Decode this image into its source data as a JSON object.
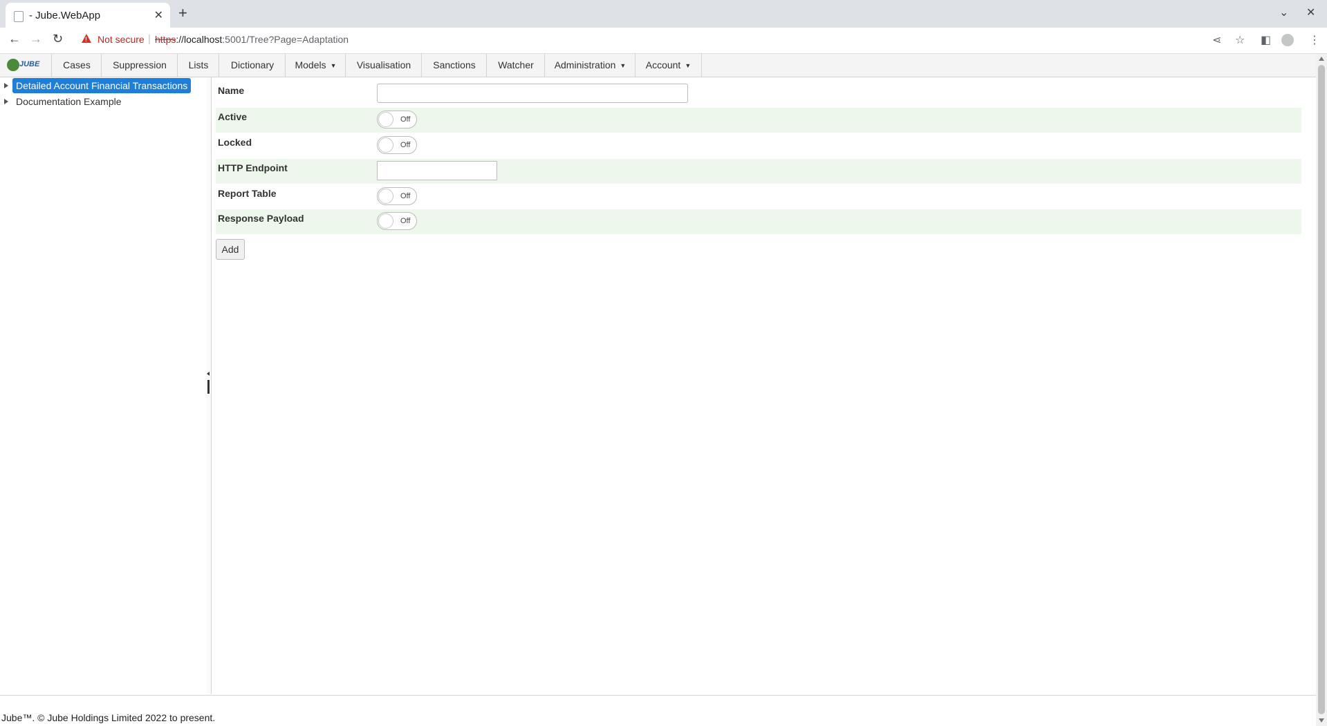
{
  "browser": {
    "tab_title": "- Jube.WebApp",
    "security_label": "Not secure",
    "url_scheme": "https",
    "url_host": "://localhost",
    "url_rest": ":5001/Tree?Page=Adaptation"
  },
  "app": {
    "logo_text": "JUBE",
    "nav": [
      {
        "label": "Cases"
      },
      {
        "label": "Suppression"
      },
      {
        "label": "Lists"
      },
      {
        "label": "Dictionary"
      },
      {
        "label": "Models",
        "dropdown": true
      },
      {
        "label": "Visualisation"
      },
      {
        "label": "Sanctions"
      },
      {
        "label": "Watcher"
      },
      {
        "label": "Administration",
        "dropdown": true
      },
      {
        "label": "Account",
        "dropdown": true
      }
    ]
  },
  "tree": {
    "items": [
      {
        "label": "Detailed Account Financial Transactions",
        "selected": true
      },
      {
        "label": "Documentation Example",
        "selected": false
      }
    ]
  },
  "form": {
    "name_label": "Name",
    "name_value": "",
    "active_label": "Active",
    "active_state": "Off",
    "locked_label": "Locked",
    "locked_state": "Off",
    "http_label": "HTTP Endpoint",
    "http_value": "",
    "report_label": "Report Table",
    "report_state": "Off",
    "response_label": "Response Payload",
    "response_state": "Off",
    "add_label": "Add"
  },
  "footer": {
    "text": "Jube™. © Jube Holdings Limited 2022 to present."
  },
  "colors": {
    "selected_tree": "#1e7ed8",
    "alt_row": "#eef7ec",
    "not_secure": "#c5221f"
  }
}
